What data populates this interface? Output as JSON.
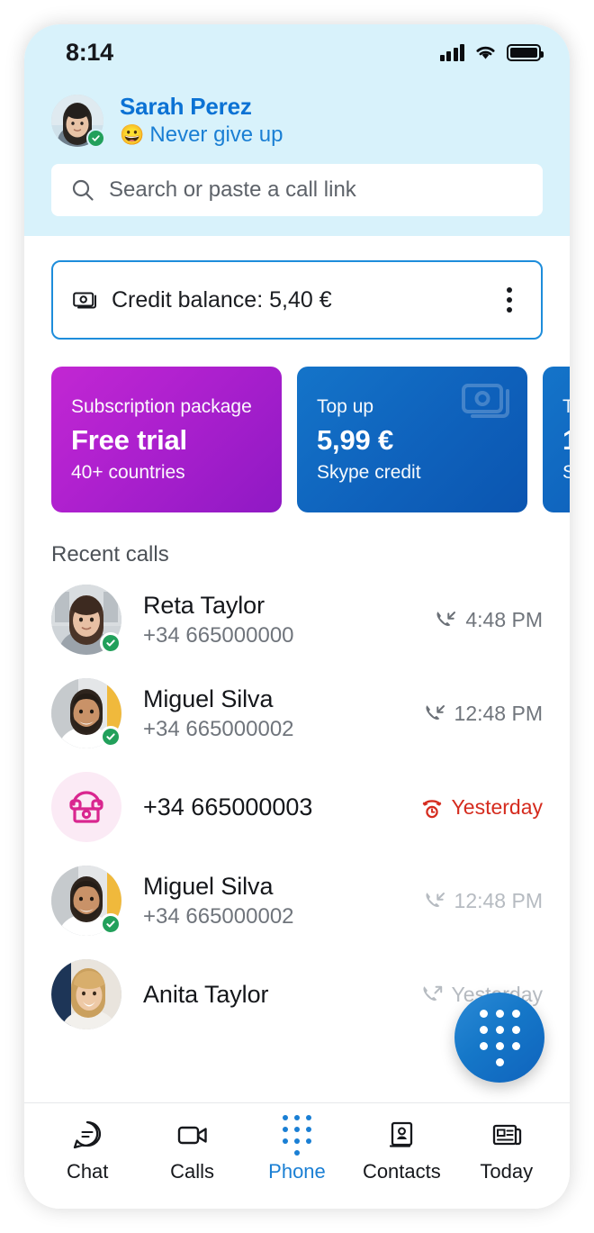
{
  "status_bar": {
    "time": "8:14",
    "signal_icon": "cellular-signal-icon",
    "wifi_icon": "wifi-icon",
    "battery_icon": "battery-full-icon"
  },
  "profile": {
    "name": "Sarah Perez",
    "mood_emoji": "😀",
    "mood_text": "Never give up",
    "presence": "available",
    "avatar_icon": "user-avatar"
  },
  "search": {
    "placeholder": "Search or paste a call link",
    "icon": "search-icon"
  },
  "credit": {
    "icon": "banknote-icon",
    "label": "Credit balance: 5,40 €",
    "menu_icon": "more-vertical-icon"
  },
  "promos": [
    {
      "label": "Subscription package",
      "value": "Free trial",
      "sub": "40+ countries",
      "color": "#b021cf"
    },
    {
      "label": "Top up",
      "value": "5,99 €",
      "sub": "Skype credit",
      "color": "#0f63bd",
      "bg_icon": "banknote-icon"
    },
    {
      "label": "T",
      "value": "1",
      "sub": "S",
      "color": "#0f63bd"
    }
  ],
  "recent_calls": {
    "title": "Recent calls",
    "items": [
      {
        "name": "Reta Taylor",
        "number": "+34 665000000",
        "time": "4:48 PM",
        "call_type": "incoming",
        "call_icon": "call-incoming-icon",
        "presence": "available",
        "avatar_icon": "user-avatar"
      },
      {
        "name": "Miguel Silva",
        "number": "+34 665000002",
        "time": "12:48 PM",
        "call_type": "incoming",
        "call_icon": "call-incoming-icon",
        "presence": "available",
        "avatar_icon": "user-avatar"
      },
      {
        "name": "",
        "number": "+34 665000003",
        "time": "Yesterday",
        "call_type": "missed",
        "call_icon": "call-missed-icon",
        "presence": "none",
        "avatar_icon": "telephone-icon"
      },
      {
        "name": "Miguel Silva",
        "number": "+34 665000002",
        "time": "12:48 PM",
        "call_type": "incoming",
        "call_icon": "call-incoming-icon",
        "presence": "available",
        "avatar_icon": "user-avatar"
      },
      {
        "name": "Anita Taylor",
        "number": "",
        "time": "Yesterday",
        "call_type": "outgoing",
        "call_icon": "call-outgoing-icon",
        "presence": "none",
        "avatar_icon": "user-avatar"
      }
    ]
  },
  "fab": {
    "icon": "dialpad-icon"
  },
  "bottom_nav": {
    "active": "Phone",
    "items": [
      {
        "label": "Chat",
        "icon": "chat-bubble-icon"
      },
      {
        "label": "Calls",
        "icon": "video-camera-icon"
      },
      {
        "label": "Phone",
        "icon": "dialpad-icon"
      },
      {
        "label": "Contacts",
        "icon": "contacts-book-icon"
      },
      {
        "label": "Today",
        "icon": "news-icon"
      }
    ]
  },
  "colors": {
    "header_bg": "#d8f2fb",
    "accent_blue": "#1a7fd4",
    "missed_red": "#d52b1e",
    "presence_green": "#22a05b",
    "phone_pink": "#d9268f"
  }
}
